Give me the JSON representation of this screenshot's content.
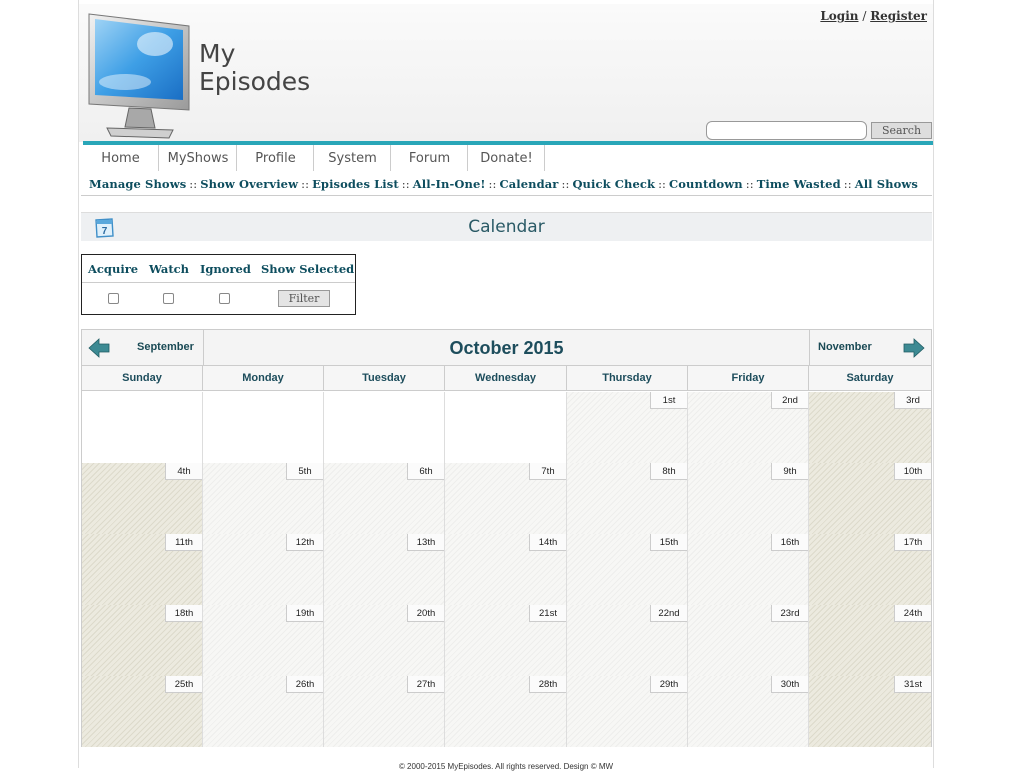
{
  "header": {
    "logo_line1": "My",
    "logo_line2": "Episodes",
    "login_label": "Login",
    "login_separator": "/",
    "register_label": "Register",
    "search_placeholder": "",
    "search_button": "Search"
  },
  "nav": {
    "tabs": [
      {
        "label": "Home"
      },
      {
        "label": "MyShows"
      },
      {
        "label": "Profile"
      },
      {
        "label": "System"
      },
      {
        "label": "Forum"
      },
      {
        "label": "Donate!"
      }
    ]
  },
  "subnav": {
    "separator": "::",
    "links": [
      {
        "label": "Manage Shows"
      },
      {
        "label": "Show Overview"
      },
      {
        "label": "Episodes List"
      },
      {
        "label": "All-In-One!"
      },
      {
        "label": "Calendar"
      },
      {
        "label": "Quick Check"
      },
      {
        "label": "Countdown"
      },
      {
        "label": "Time Wasted"
      },
      {
        "label": "All Shows"
      }
    ]
  },
  "page_title": "Calendar",
  "page_icon_number": "7",
  "filter": {
    "headers": [
      "Acquire",
      "Watch",
      "Ignored",
      "Show Selected"
    ],
    "checked": [
      false,
      false,
      false
    ],
    "button": "Filter"
  },
  "calendar": {
    "prev_month": "September",
    "month_title": "October 2015",
    "next_month": "November",
    "weekdays": [
      "Sunday",
      "Monday",
      "Tuesday",
      "Wednesday",
      "Thursday",
      "Friday",
      "Saturday"
    ],
    "weeks": [
      [
        "",
        "",
        "",
        "",
        "1st",
        "2nd",
        "3rd"
      ],
      [
        "4th",
        "5th",
        "6th",
        "7th",
        "8th",
        "9th",
        "10th"
      ],
      [
        "11th",
        "12th",
        "13th",
        "14th",
        "15th",
        "16th",
        "17th"
      ],
      [
        "18th",
        "19th",
        "20th",
        "21st",
        "22nd",
        "23rd",
        "24th"
      ],
      [
        "25th",
        "26th",
        "27th",
        "28th",
        "29th",
        "30th",
        "31st"
      ]
    ]
  },
  "footer": "© 2000-2015 MyEpisodes. All rights reserved. Design © MW",
  "colors": {
    "accent": "#29a6b8",
    "link": "#0d4d5e",
    "weekend": "#eceadf"
  }
}
